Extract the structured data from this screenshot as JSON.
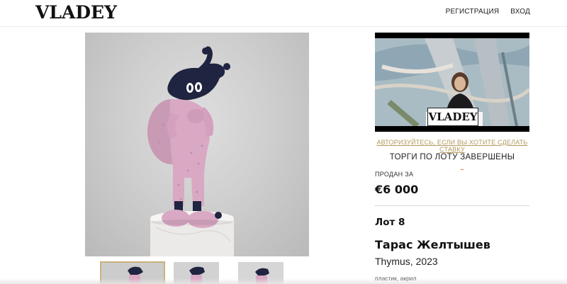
{
  "header": {
    "logo": "VLADEY",
    "nav": [
      {
        "label": "РЕГИСТРАЦИЯ"
      },
      {
        "label": "ВХОД"
      }
    ]
  },
  "video": {
    "overlay_logo": "VLADEY"
  },
  "auction": {
    "auth_prompt": "АВТОРИЗУЙТЕСЬ, ЕСЛИ ВЫ ХОТИТЕ СДЕЛАТЬ СТАВКУ",
    "status": "ТОРГИ ПО ЛОТУ ЗАВЕРШЕНЫ",
    "sold_label": "ПРОДАН ЗА",
    "sold_price": "€6 000"
  },
  "lot": {
    "number": "Лот 8",
    "artist": "Тарас Желтышев",
    "title_year": "Thymus, 2023",
    "medium": "пластик, акрил"
  },
  "gallery": {
    "thumbnail_count": 3,
    "active_index": 0
  },
  "colors": {
    "accent_gold": "#b29a5c",
    "figure_pink": "#d9a9c4",
    "figure_navy": "#1f2440"
  }
}
